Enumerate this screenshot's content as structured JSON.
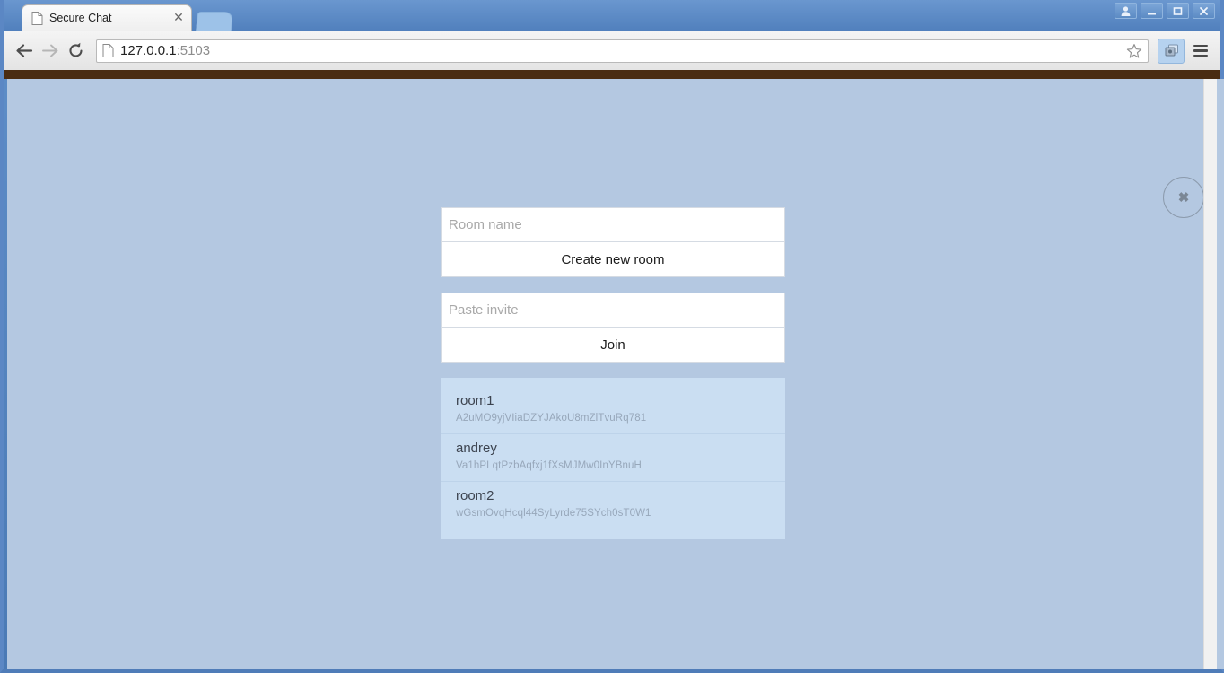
{
  "browser": {
    "tab": {
      "title": "Secure Chat",
      "favicon_icon": "document-icon",
      "close_icon": "close-icon"
    },
    "new_tab_icon": "new-tab-icon",
    "window_controls": [
      {
        "name": "user-avatar-button",
        "icon": "person-icon"
      },
      {
        "name": "minimize-button",
        "icon": "minimize-icon"
      },
      {
        "name": "maximize-button",
        "icon": "maximize-icon"
      },
      {
        "name": "window-close-button",
        "icon": "close-icon"
      }
    ],
    "toolbar": {
      "back_icon": "arrow-left-icon",
      "forward_icon": "arrow-right-icon",
      "reload_icon": "reload-icon",
      "page_icon": "document-icon",
      "url_host": "127.0.0.1",
      "url_port": ":5103",
      "bookmark_icon": "star-icon",
      "extension_icon": "extension-icon",
      "menu_icon": "hamburger-menu-icon"
    }
  },
  "page": {
    "close_button": {
      "glyph": "✖",
      "icon": "close-icon"
    },
    "create": {
      "room_name_placeholder": "Room name",
      "room_name_value": "",
      "button_label": "Create new room"
    },
    "join": {
      "invite_placeholder": "Paste invite",
      "invite_value": "",
      "button_label": "Join"
    },
    "rooms": [
      {
        "name": "room1",
        "id": "A2uMO9yjVIiaDZYJAkoU8mZlTvuRq781"
      },
      {
        "name": "andrey",
        "id": "Va1hPLqtPzbAqfxj1fXsMJMw0InYBnuH"
      },
      {
        "name": "room2",
        "id": "wGsmOvqHcql44SyLyrde75SYch0sT0W1"
      }
    ]
  },
  "colors": {
    "page_background": "#b4c8e1",
    "roomlist_background": "#cadef2",
    "brown_bar": "#4a2c12",
    "field_background": "#ffffff",
    "field_border": "#d5dbe3",
    "placeholder_text": "#a9a9a9",
    "room_id_text": "#97a7ba"
  }
}
